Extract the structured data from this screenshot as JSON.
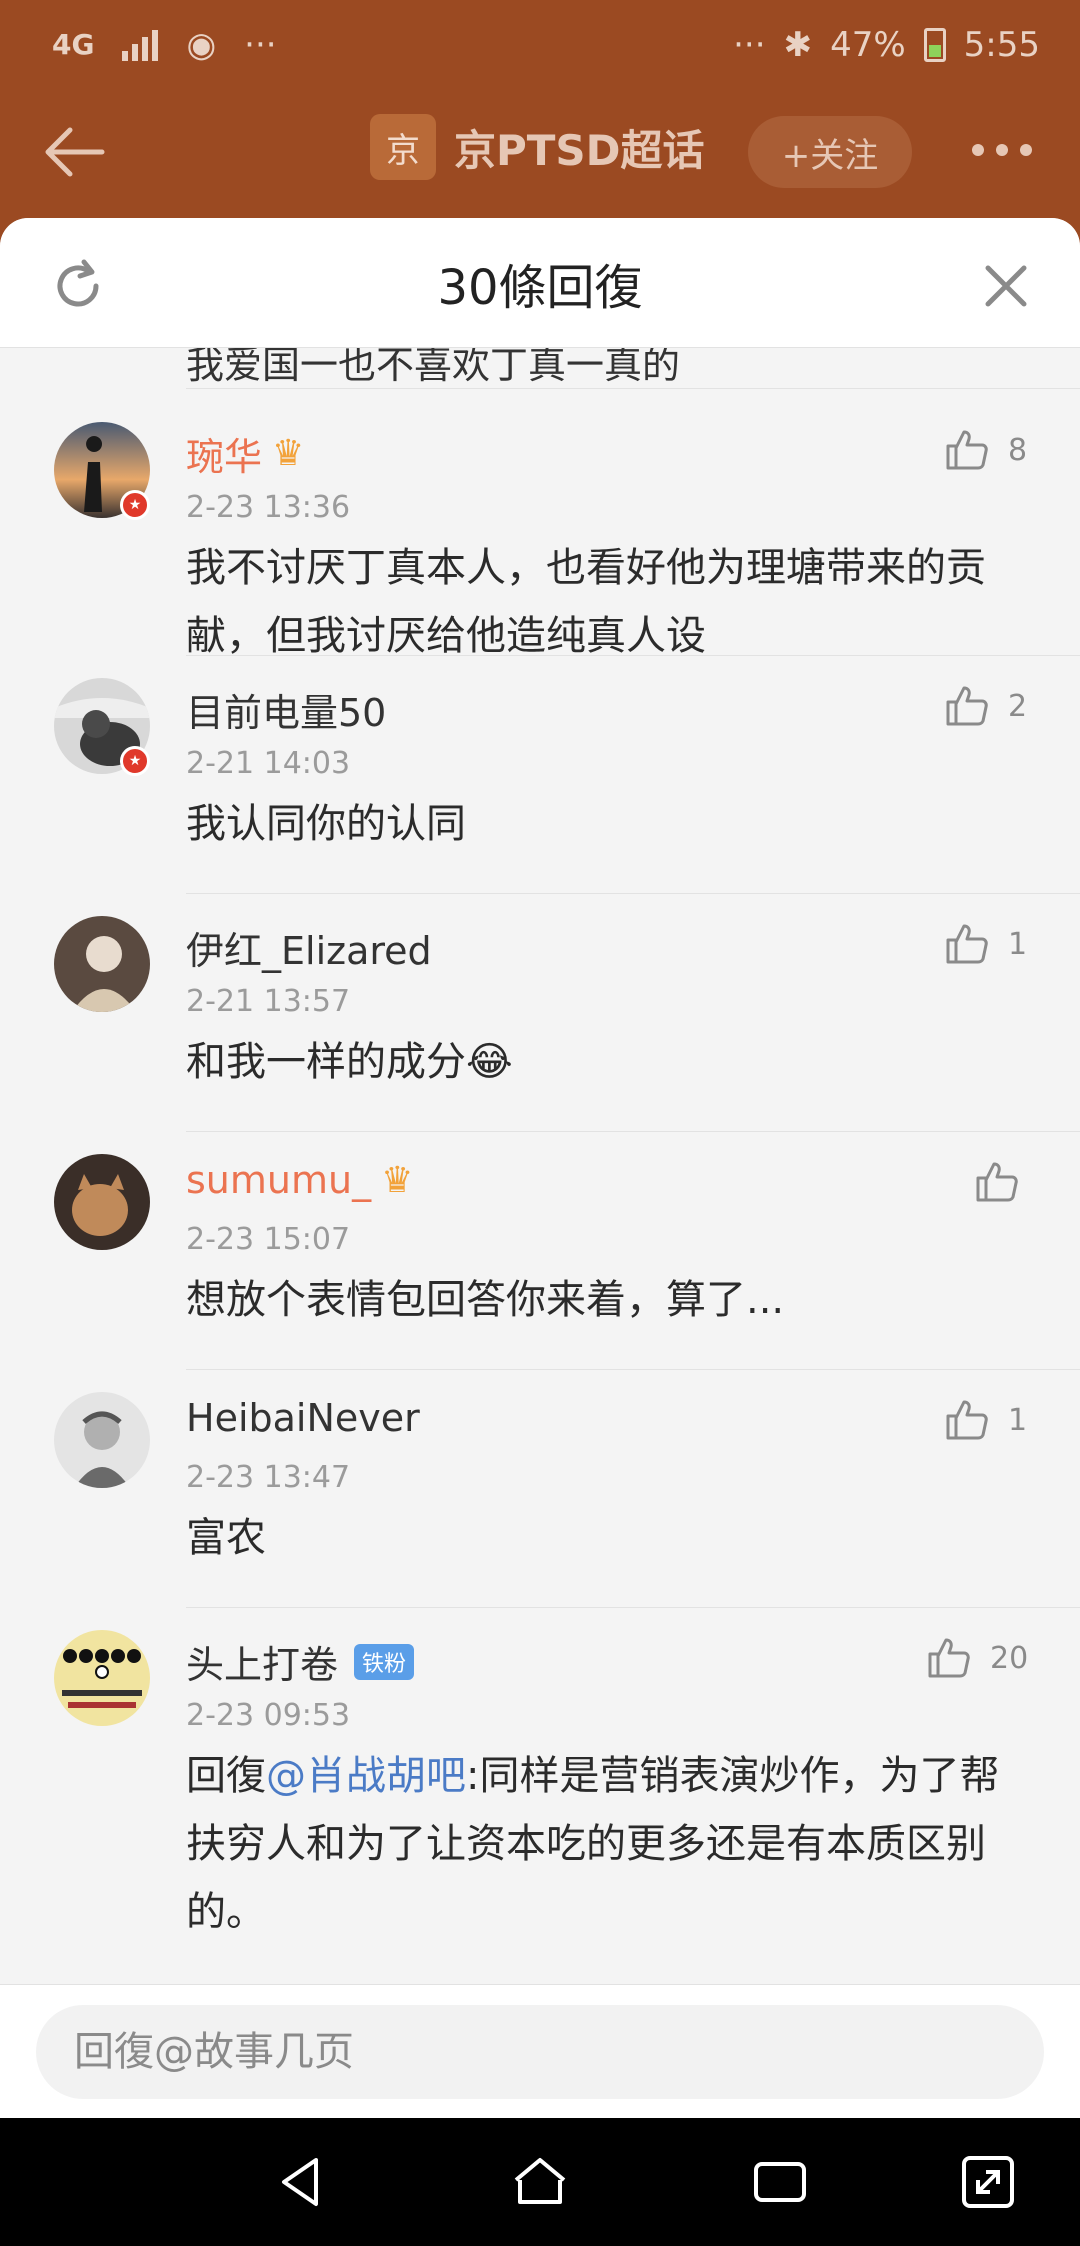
{
  "status_bar": {
    "network": "4G",
    "overflow_left": "···",
    "overflow_right": "···",
    "battery": "47%",
    "time": "5:55"
  },
  "topic": {
    "logo_char": "京",
    "name": "京PTSD超话",
    "follow_label": "+关注"
  },
  "sheet": {
    "title": "30條回復",
    "partial_text": "我爱国一也不喜欢丁真一真的"
  },
  "comments": [
    {
      "user": "琬华",
      "vip": true,
      "badge": "",
      "time": "2-23 13:36",
      "text": "我不讨厌丁真本人，也看好他为理塘带来的贡献，但我讨厌给他造纯真人设",
      "likes": "8"
    },
    {
      "user": "目前电量50",
      "vip": false,
      "badge": "",
      "time": "2-21 14:03",
      "text": "我认同你的认同",
      "likes": "2"
    },
    {
      "user": "伊红_Elizared",
      "vip": false,
      "badge": "",
      "time": "2-21 13:57",
      "text": "和我一样的成分😂",
      "likes": "1"
    },
    {
      "user": "sumumu_",
      "vip": true,
      "badge": "",
      "time": "2-23 15:07",
      "text": "想放个表情包回答你来着，算了...",
      "likes": ""
    },
    {
      "user": "HeibaiNever",
      "vip": false,
      "badge": "",
      "time": "2-23 13:47",
      "text": "富农",
      "likes": "1"
    },
    {
      "user": "头上打卷",
      "vip": false,
      "badge": "铁粉",
      "time": "2-23 09:53",
      "reply_prefix": "回復",
      "mention": "@肖战胡吧",
      "text": ":同样是营销表演炒作，为了帮扶穷人和为了让资本吃的更多还是有本质区别的。",
      "likes": "20"
    }
  ],
  "reply": {
    "placeholder": "回復@故事几页"
  },
  "colors": {
    "accent_orange": "#eb7350",
    "mention_blue": "#4b7bc6",
    "topic_bar": "#9b4a22"
  }
}
